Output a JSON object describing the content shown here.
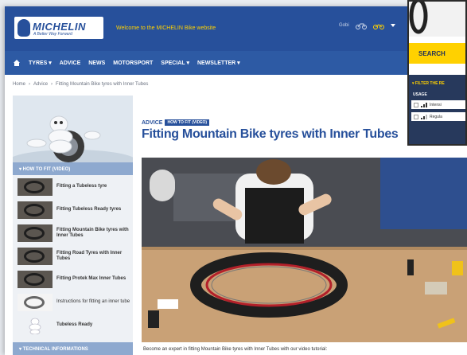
{
  "header": {
    "logo_name": "MICHELIN",
    "logo_tagline": "A Better Way Forward",
    "welcome": "Welcome to the MICHELIN Bike website",
    "right_text": "Gobi"
  },
  "nav": {
    "items": [
      "TYRES ▾",
      "ADVICE",
      "NEWS",
      "MOTORSPORT",
      "SPECIAL ▾",
      "NEWSLETTER ▾"
    ]
  },
  "breadcrumb": {
    "home": "Home",
    "sep": "›",
    "advice": "Advice",
    "current": "Fitting Mountain Bike tyres with Inner Tubes"
  },
  "sidebar": {
    "section_title": "▾ HOW TO FIT (VIDEO)",
    "items": [
      {
        "label": "Fitting a Tubeless tyre"
      },
      {
        "label": "Fitting Tubeless Ready tyres"
      },
      {
        "label": "Fitting Mountain Bike tyres with Inner Tubes"
      },
      {
        "label": "Fitting Road Tyres with Inner Tubes"
      },
      {
        "label": "Fitting Protek Max Inner Tubes"
      },
      {
        "label": "Instructions for fitting an inner tube"
      },
      {
        "label": "Tubeless Ready"
      }
    ],
    "section_title_2": "▾ TECHNICAL INFORMATIONS"
  },
  "content": {
    "advice_label": "ADVICE",
    "badge": "HOW TO FIT (VIDEO)",
    "title": "Fitting Mountain Bike tyres with Inner Tubes",
    "caption": "Become an expert in fitting Mountain Bike tyres with Inner Tubes with our video tutorial:"
  },
  "overlay": {
    "search_label": "SEARCH",
    "filter_label": "▾ FILTER THE RE",
    "usage_label": "USAGE",
    "options": [
      "Intensi",
      "Regula"
    ]
  },
  "colors": {
    "brand_blue": "#27509b",
    "accent_yellow": "#ffd100"
  }
}
